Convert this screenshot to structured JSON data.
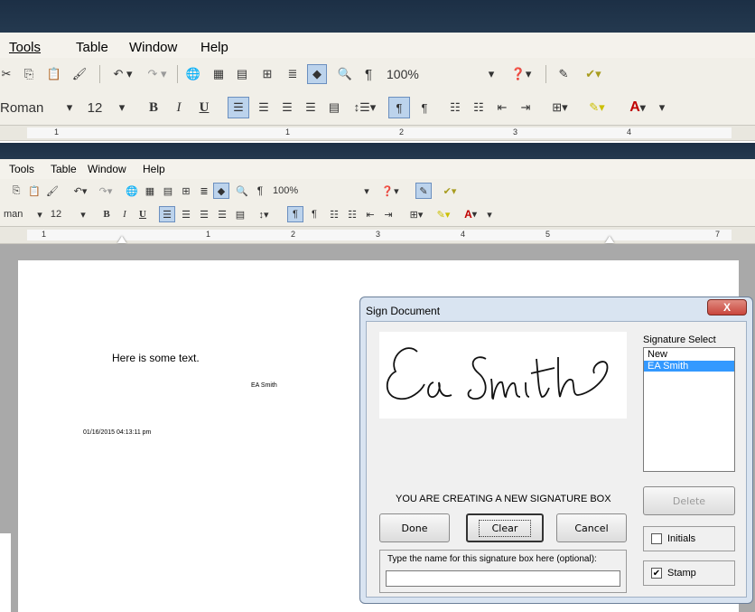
{
  "top_window": {
    "menu": [
      "Tools",
      "Table",
      "Window",
      "Help"
    ],
    "zoom": "100%",
    "font_name": "Roman",
    "font_size": "12",
    "ruler_numbers": [
      "1",
      "1",
      "2",
      "3",
      "4"
    ]
  },
  "main_window": {
    "menu": [
      "Tools",
      "Table",
      "Window",
      "Help"
    ],
    "zoom": "100%",
    "font_name": "man",
    "font_size": "12",
    "ruler_numbers": [
      "1",
      "1",
      "2",
      "3",
      "4",
      "5",
      "7"
    ]
  },
  "document": {
    "body_text": "Here is some text.",
    "signature_label": "EA Smith",
    "timestamp": "01/16/2015 04:13:11 pm"
  },
  "dialog": {
    "title": "Sign Document",
    "close_glyph": "X",
    "signature_text": "Ea Smith",
    "signature_select_label": "Signature Select",
    "signature_options": [
      "New",
      "EA Smith"
    ],
    "selected_option": "EA Smith",
    "delete_label": "Delete",
    "status_message": "YOU ARE CREATING A NEW SIGNATURE BOX",
    "done_label": "Done",
    "clear_label": "Clear",
    "cancel_label": "Cancel",
    "initials_label": "Initials",
    "initials_checked": false,
    "stamp_label": "Stamp",
    "stamp_checked": true,
    "name_prompt": "Type the name for this signature box here (optional):",
    "name_value": ""
  },
  "colors": {
    "titlebar": "#1c2f45",
    "selection": "#3399ff",
    "close_button": "#c9463d"
  }
}
